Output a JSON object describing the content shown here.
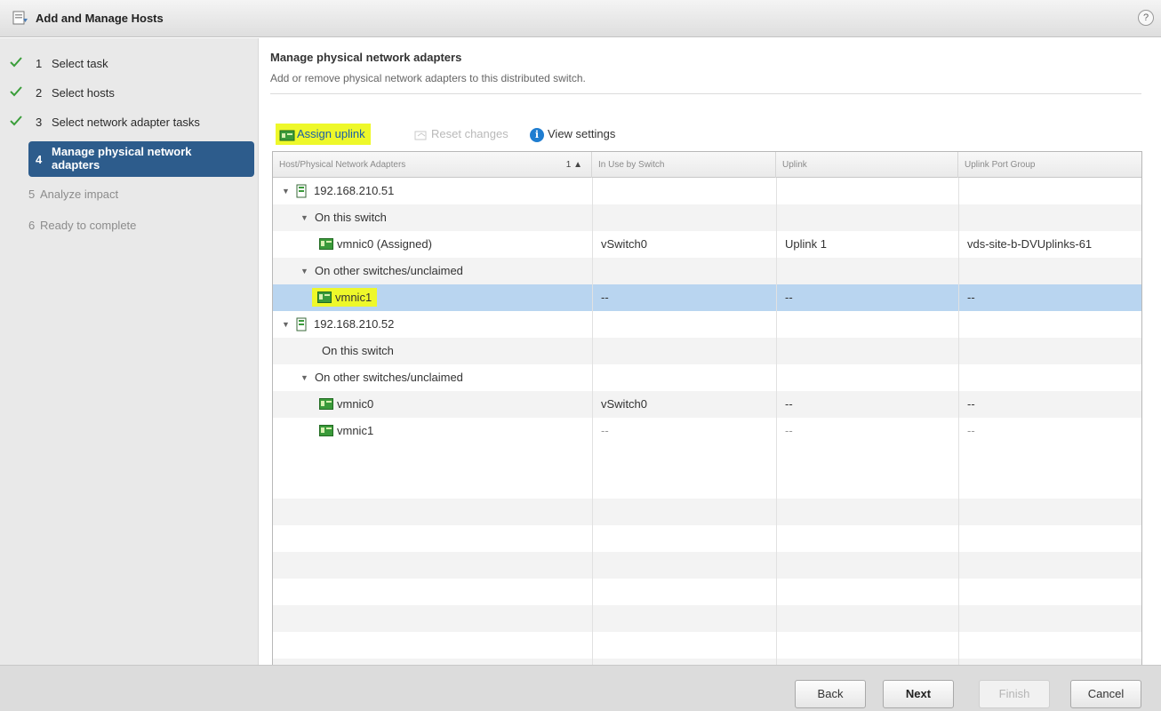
{
  "window": {
    "title": "Add and Manage Hosts",
    "help_label": "?"
  },
  "steps": [
    {
      "num": "1",
      "label": "Select task",
      "state": "done"
    },
    {
      "num": "2",
      "label": "Select hosts",
      "state": "done"
    },
    {
      "num": "3",
      "label": "Select network adapter tasks",
      "state": "done"
    },
    {
      "num": "4",
      "label": "Manage physical network adapters",
      "state": "active"
    },
    {
      "num": "5",
      "label": "Analyze impact",
      "state": "todo"
    },
    {
      "num": "6",
      "label": "Ready to complete",
      "state": "todo"
    }
  ],
  "page": {
    "title": "Manage physical network adapters",
    "description": "Add or remove physical network adapters to this distributed switch."
  },
  "toolbar": {
    "assign_label": "Assign uplink",
    "reset_label": "Reset changes",
    "view_label": "View settings"
  },
  "table": {
    "columns": [
      "Host/Physical Network Adapters",
      "In Use by Switch",
      "Uplink",
      "Uplink Port Group"
    ],
    "sort_indicator": "1 ▲",
    "rows": [
      {
        "type": "host",
        "name": "192.168.210.51",
        "switch": "",
        "uplink": "",
        "portgroup": ""
      },
      {
        "type": "group",
        "name": "On this switch",
        "switch": "",
        "uplink": "",
        "portgroup": ""
      },
      {
        "type": "nic",
        "name": "vmnic0 (Assigned)",
        "switch": "vSwitch0",
        "uplink": "Uplink 1",
        "portgroup": "vds-site-b-DVUplinks-61"
      },
      {
        "type": "group",
        "name": "On other switches/unclaimed",
        "switch": "",
        "uplink": "",
        "portgroup": ""
      },
      {
        "type": "nic",
        "name": "vmnic1",
        "switch": "--",
        "uplink": "--",
        "portgroup": "--",
        "selected": true
      },
      {
        "type": "host",
        "name": "192.168.210.52",
        "switch": "",
        "uplink": "",
        "portgroup": ""
      },
      {
        "type": "group-empty",
        "name": "On this switch",
        "switch": "",
        "uplink": "",
        "portgroup": ""
      },
      {
        "type": "group",
        "name": "On other switches/unclaimed",
        "switch": "",
        "uplink": "",
        "portgroup": ""
      },
      {
        "type": "nic",
        "name": "vmnic0",
        "switch": "vSwitch0",
        "uplink": "--",
        "portgroup": "--"
      },
      {
        "type": "nic",
        "name": "vmnic1",
        "switch": "--",
        "uplink": "--",
        "portgroup": "--"
      }
    ]
  },
  "footer": {
    "back": "Back",
    "next": "Next",
    "finish": "Finish",
    "cancel": "Cancel"
  },
  "colors": {
    "active_step": "#2d5c8c",
    "selected_row": "#b9d5f0",
    "highlight": "#eef82a",
    "nic_icon": "#3a9a3a"
  }
}
